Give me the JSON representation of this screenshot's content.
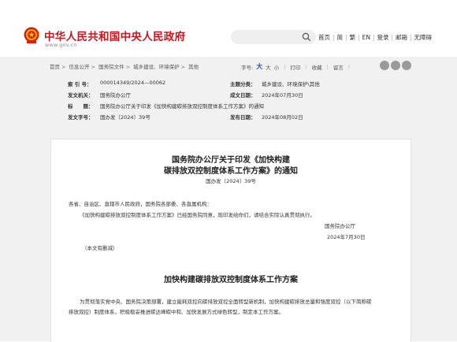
{
  "header": {
    "site_title": "中华人民共和国中央人民政府",
    "site_url": "www.gov.cn",
    "brand_color": "#c8161e",
    "nav": [
      "首页",
      "简",
      "繁",
      "EN",
      "登录",
      "邮箱",
      "无障碍"
    ]
  },
  "breadcrumb": [
    "首页",
    "信息公开",
    "国务院文件",
    "城乡建设、环境保护",
    "其他"
  ],
  "tools": {
    "font_size_label": "字号:",
    "large": "大",
    "medium": "大",
    "small": "小",
    "print": "打印",
    "favorite": "收藏",
    "comment": "留言"
  },
  "info": {
    "index_key": "索 引 号：",
    "index_val": "000014349/2024—00062",
    "topic_key": "主题分类：",
    "topic_val": "城乡建设、环境保护\\其他",
    "issuer_key": "发文机关：",
    "issuer_val": "国务院办公厅",
    "date_written_key": "成文日期：",
    "date_written_val": "2024年07月30日",
    "title_key": "标　　题：",
    "title_val": "国务院办公厅关于印发《加快构建碳排放双控制度体系工作方案》的通知",
    "docno_key": "发文字号：",
    "docno_val": "国办发〔2024〕39号",
    "pubdate_key": "发布日期：",
    "pubdate_val": "2024年08月02日"
  },
  "document": {
    "title_line1": "国务院办公厅关于印发《加快构建",
    "title_line2": "碳排放双控制度体系工作方案》的通知",
    "doc_number": "国办发〔2024〕39号",
    "salutation": "各省、自治区、直辖市人民政府，国务院各部委、各直属机构：",
    "body": "《加快构建碳排放双控制度体系工作方案》已经国务院同意，现印发给你们，请结合实际认真贯彻执行。",
    "signer": "国务院办公厅",
    "sign_date": "2024年7月30日",
    "note": "（本文有删减）",
    "plan_title": "加快构建碳排放双控制度体系工作方案",
    "plan_para_line1": "为贯彻落实党中央、国务院决策部署，建立能耗双控向碳排放双控全面转型新机制，加快构建碳排放总量和强度双控（以下简称碳",
    "plan_para_line2": "排放双控）制度体系，积极稳妥推进碳达峰碳中和、加快发展方式绿色转型，制定本工作方案。"
  }
}
